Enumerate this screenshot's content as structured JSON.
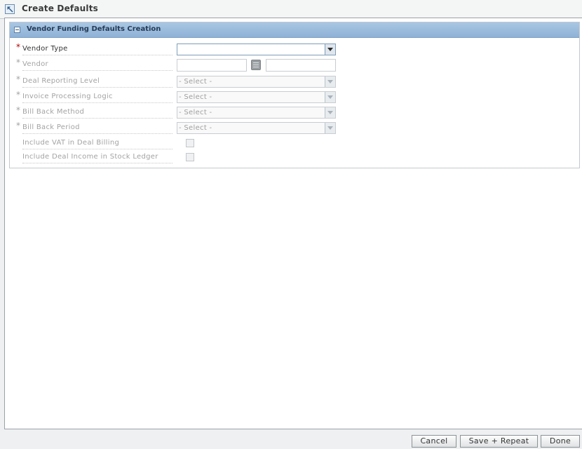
{
  "window": {
    "title": "Create Defaults",
    "icon": "arrow-up-left-icon"
  },
  "section": {
    "title": "Vendor Funding Defaults Creation",
    "collapse_icon": "collapse-minus-icon"
  },
  "form": {
    "vendor_type": {
      "label": "Vendor Type",
      "required_marker": "*",
      "value": ""
    },
    "vendor": {
      "label": "Vendor",
      "required_marker": "*",
      "id_value": "",
      "name_value": ""
    },
    "deal_reporting_level": {
      "label": "Deal Reporting Level",
      "required_marker": "*",
      "value": "- Select -"
    },
    "invoice_processing_logic": {
      "label": "Invoice Processing Logic",
      "required_marker": "*",
      "value": "- Select -"
    },
    "bill_back_method": {
      "label": "Bill Back Method",
      "required_marker": "*",
      "value": "- Select -"
    },
    "bill_back_period": {
      "label": "Bill Back Period",
      "required_marker": "*",
      "value": "- Select -"
    },
    "include_vat": {
      "label": "Include VAT in Deal Billing",
      "checked": false
    },
    "include_deal_income": {
      "label": "Include Deal Income in Stock Ledger",
      "checked": false
    }
  },
  "footer": {
    "cancel_label": "Cancel",
    "save_repeat_label": "Save + Repeat",
    "done_label": "Done"
  },
  "colors": {
    "section_header": "#8fb2d6",
    "required": "#b30000",
    "disabled_text": "#a3a3a3"
  }
}
